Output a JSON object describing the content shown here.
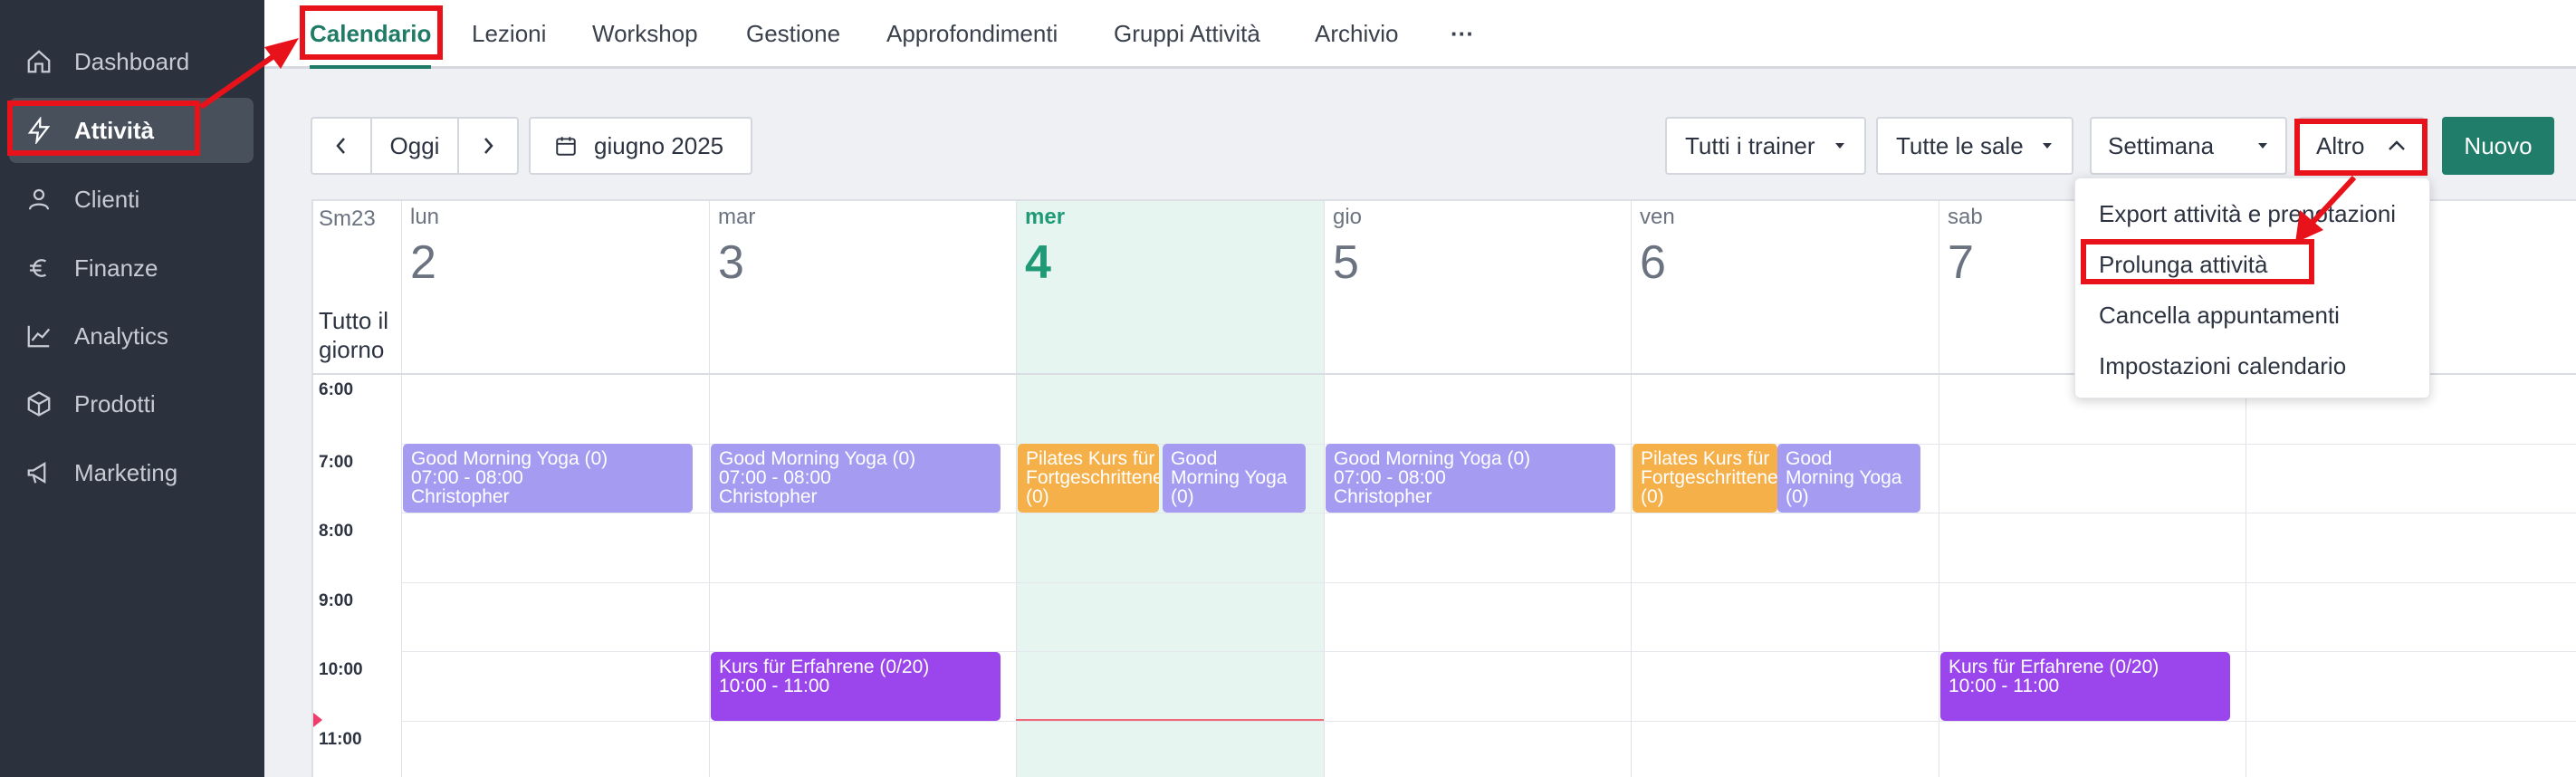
{
  "sidebar": {
    "items": [
      {
        "label": "Dashboard",
        "icon": "home-icon"
      },
      {
        "label": "Attività",
        "icon": "bolt-icon",
        "active": true
      },
      {
        "label": "Clienti",
        "icon": "user-icon"
      },
      {
        "label": "Finanze",
        "icon": "euro-icon"
      },
      {
        "label": "Analytics",
        "icon": "chart-line-icon"
      },
      {
        "label": "Prodotti",
        "icon": "box-icon"
      },
      {
        "label": "Marketing",
        "icon": "megaphone-icon"
      }
    ]
  },
  "tabs": [
    "Calendario",
    "Lezioni",
    "Workshop",
    "Gestione",
    "Approfondimenti",
    "Gruppi Attività",
    "Archivio",
    "···"
  ],
  "toolbar": {
    "today": "Oggi",
    "month": "giugno 2025",
    "trainers": "Tutti i trainer",
    "rooms": "Tutte le sale",
    "view": "Settimana",
    "more": "Altro",
    "new": "Nuovo"
  },
  "calendar": {
    "week_label": "Sm23",
    "all_day": "Tutto il giorno",
    "days": [
      {
        "name": "lun",
        "num": "2"
      },
      {
        "name": "mar",
        "num": "3"
      },
      {
        "name": "mer",
        "num": "4",
        "today": true
      },
      {
        "name": "gio",
        "num": "5"
      },
      {
        "name": "ven",
        "num": "6"
      },
      {
        "name": "sab",
        "num": "7"
      }
    ],
    "times": [
      "6:00",
      "7:00",
      "8:00",
      "9:00",
      "10:00",
      "11:00"
    ],
    "events": {
      "yoga_title": "Good Morning Yoga (0)",
      "yoga_time": "07:00 - 08:00",
      "yoga_trainer": "Christopher",
      "yoga_short1": "Good",
      "yoga_short2": "Morning Yoga",
      "yoga_short3": "(0)",
      "pilates1": "Pilates Kurs für",
      "pilates2": "Fortgeschrittene",
      "pilates3": "(0)",
      "kurs_title": "Kurs für Erfahrene (0/20)",
      "kurs_time": "10:00 - 11:00"
    }
  },
  "dropdown": {
    "items": [
      "Export attività e prenotazioni",
      "Prolunga attività",
      "Cancella appuntamenti",
      "Impostazioni calendario"
    ]
  },
  "colors": {
    "sidebar": "#2b323d",
    "accent": "#1f7a66",
    "yoga": "#a59cf2",
    "pilates": "#f5b04a",
    "kurs": "#9b45ec",
    "annotation": "#e8121b"
  }
}
